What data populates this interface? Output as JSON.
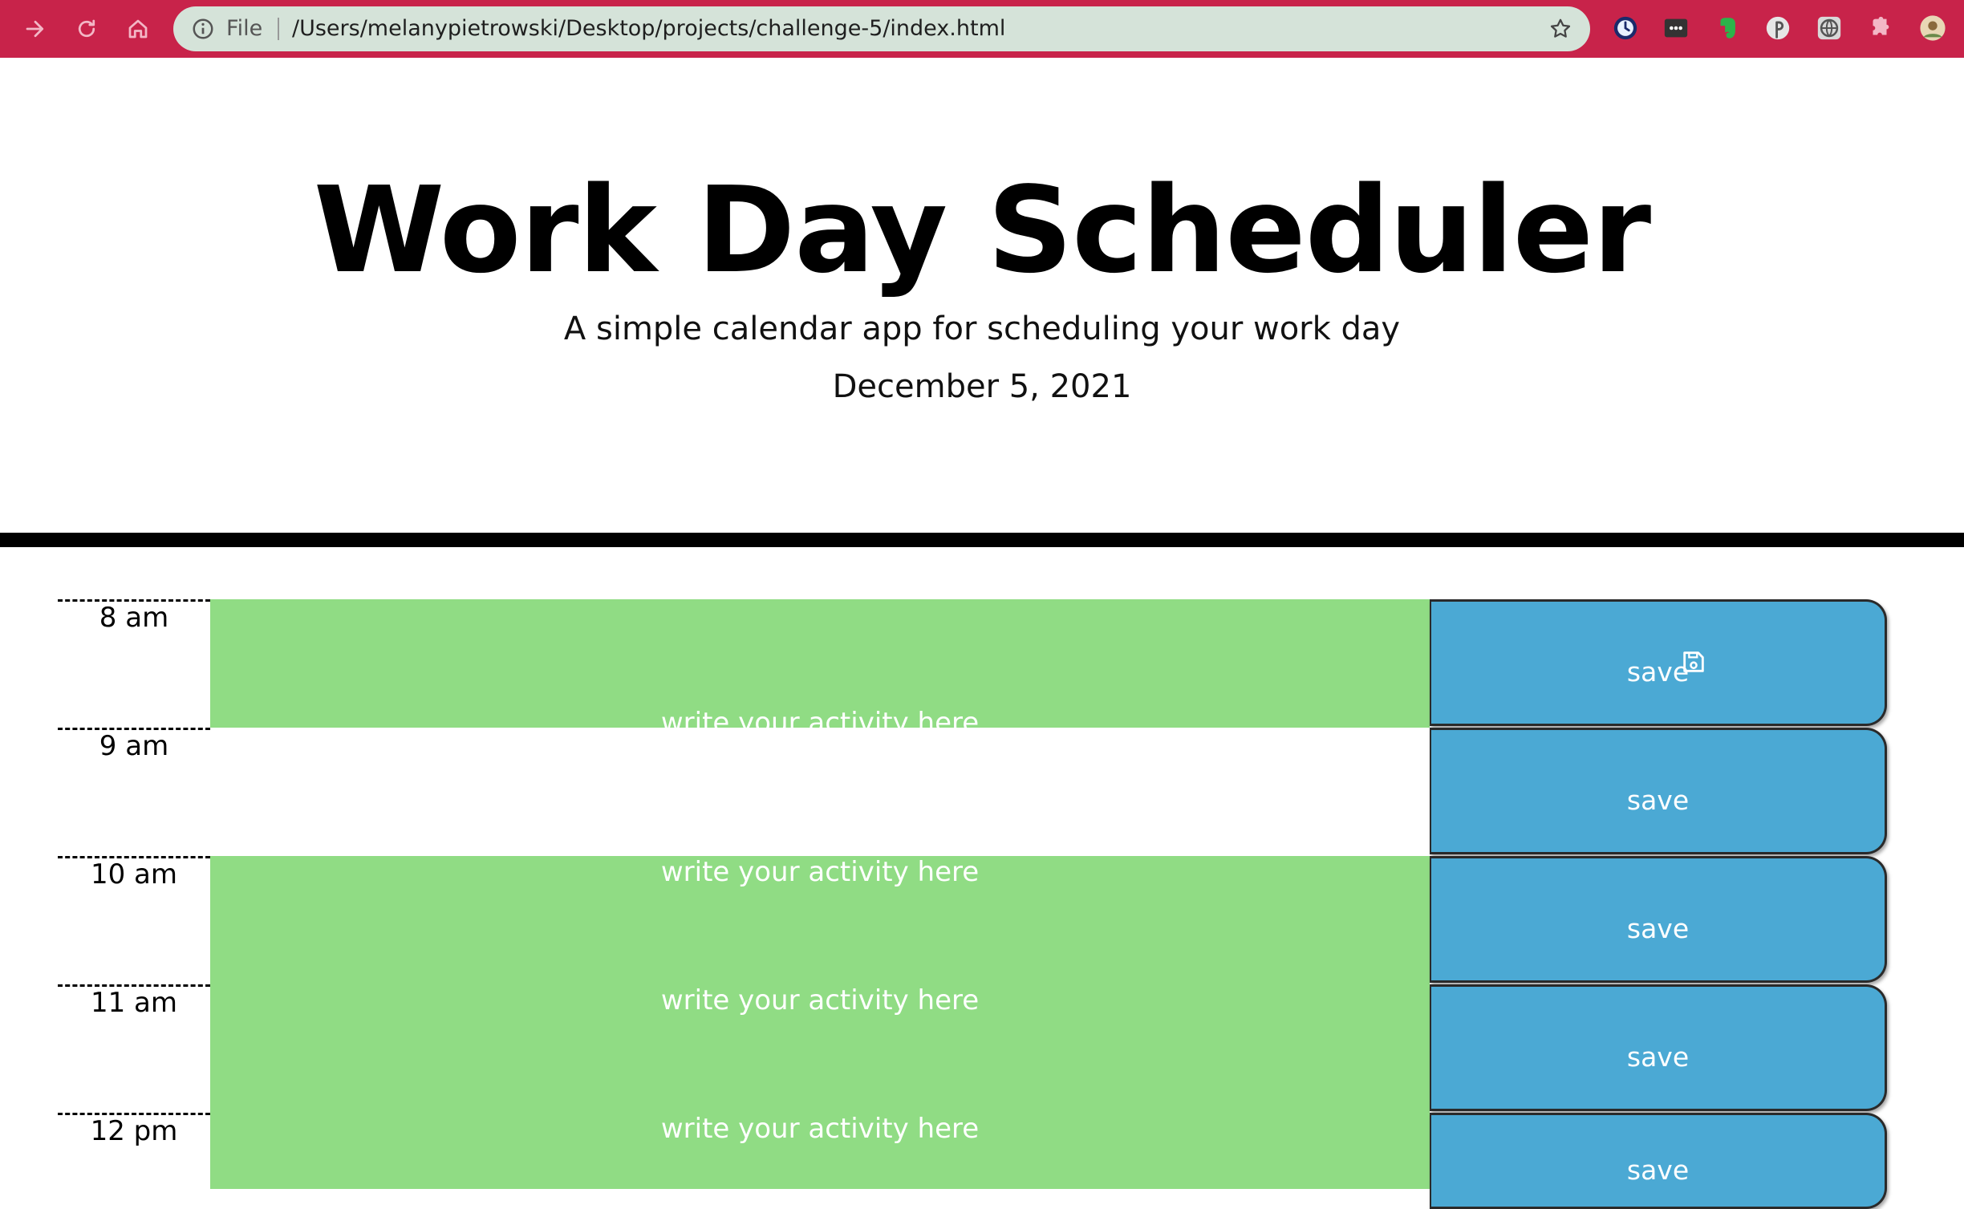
{
  "browser": {
    "file_label": "File",
    "url": "/Users/melanypietrowski/Desktop/projects/challenge-5/index.html",
    "toolbar_color": "#c8234a"
  },
  "header": {
    "title": "Work Day Scheduler",
    "lead": "A simple calendar app for scheduling your work day",
    "date": "December 5, 2021"
  },
  "schedule": {
    "rows": [
      {
        "hour": "8 am",
        "placeholder": "",
        "save_label": "save"
      },
      {
        "hour": "9 am",
        "placeholder": "write your activity here",
        "save_label": "save"
      },
      {
        "hour": "10 am",
        "placeholder": "write your activity here",
        "save_label": "save"
      },
      {
        "hour": "11 am",
        "placeholder": "write your activity here",
        "save_label": "save"
      },
      {
        "hour": "12 pm",
        "placeholder": "write your activity here",
        "save_label": "save"
      }
    ],
    "colors": {
      "present_future": "#90dc84",
      "save_button": "#4ba9d4"
    }
  }
}
